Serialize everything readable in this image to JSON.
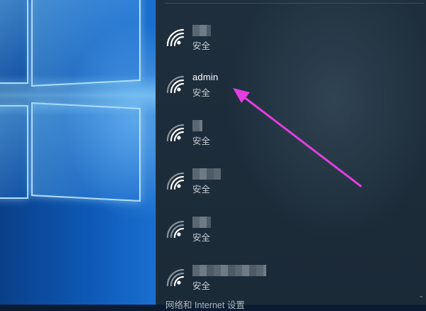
{
  "networks": [
    {
      "ssid": "",
      "status": "安全",
      "ssid_hidden": true
    },
    {
      "ssid": "admin",
      "status": "安全",
      "ssid_hidden": false
    },
    {
      "ssid": "",
      "status": "安全",
      "ssid_hidden": true
    },
    {
      "ssid": "",
      "status": "安全",
      "ssid_hidden": true
    },
    {
      "ssid": "",
      "status": "安全",
      "ssid_hidden": true
    },
    {
      "ssid": "",
      "status": "安全",
      "ssid_hidden": true
    }
  ],
  "footer": {
    "settings_link": "网络和 Internet 设置"
  },
  "icons": {
    "network": "wifi-icon",
    "scroll": "chevron-down-icon"
  },
  "colors": {
    "annotation_arrow": "#e33ee0",
    "panel": "#1e2e3c"
  }
}
